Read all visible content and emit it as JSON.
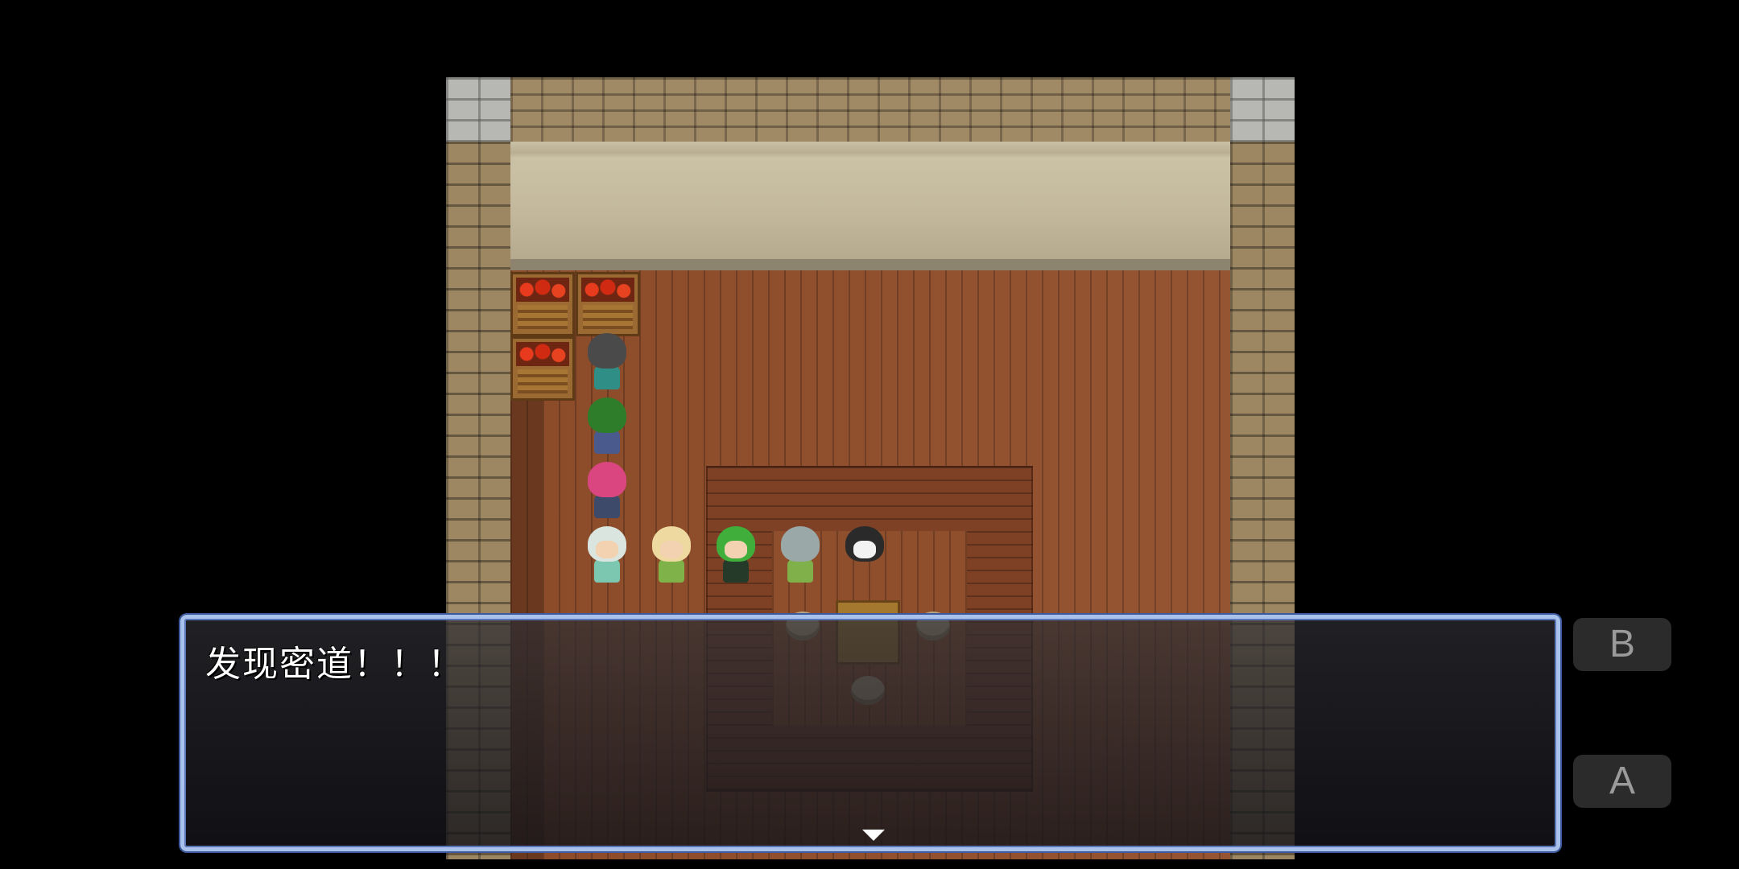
{
  "dialog": {
    "message": "发现密道！！！"
  },
  "controls": {
    "b_label": "B",
    "a_label": "A"
  },
  "colors": {
    "dialog_border": "#a9c2ec",
    "floor": "#8f4f2c",
    "wall": "#9d8662"
  },
  "characters": [
    "dark-haired-character",
    "green-spiky-character",
    "pink-haired-character",
    "silver-haired-character",
    "blonde-crowned-character",
    "green-haired-boy",
    "gray-helmet-character",
    "panda-character"
  ]
}
